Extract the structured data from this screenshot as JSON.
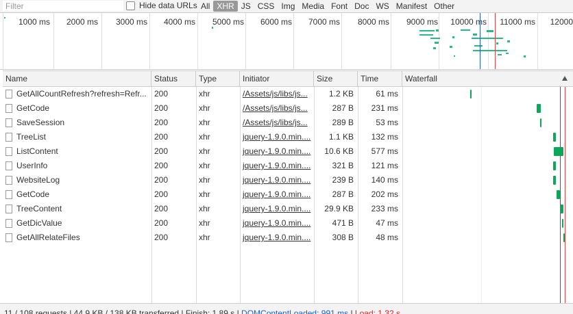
{
  "filter": {
    "placeholder": "Filter",
    "hide_data_urls": "Hide data URLs"
  },
  "type_filters": [
    "All",
    "XHR",
    "JS",
    "CSS",
    "Img",
    "Media",
    "Font",
    "Doc",
    "WS",
    "Manifest",
    "Other"
  ],
  "active_filter": "XHR",
  "overview": {
    "ticks": [
      "1000 ms",
      "2000 ms",
      "3000 ms",
      "4000 ms",
      "5000 ms",
      "6000 ms",
      "7000 ms",
      "8000 ms",
      "9000 ms",
      "10000 ms",
      "11000 ms",
      "12000"
    ]
  },
  "columns": [
    "Name",
    "Status",
    "Type",
    "Initiator",
    "Size",
    "Time",
    "Waterfall"
  ],
  "rows": [
    {
      "name": "GetAllCountRefresh?refresh=Refr...",
      "status": "200",
      "type": "xhr",
      "initiator": "/Assets/js/libs/js...",
      "size": "1.2 KB",
      "time": "61 ms"
    },
    {
      "name": "GetCode",
      "status": "200",
      "type": "xhr",
      "initiator": "/Assets/js/libs/js...",
      "size": "287 B",
      "time": "231 ms"
    },
    {
      "name": "SaveSession",
      "status": "200",
      "type": "xhr",
      "initiator": "/Assets/js/libs/js...",
      "size": "289 B",
      "time": "53 ms"
    },
    {
      "name": "TreeList",
      "status": "200",
      "type": "xhr",
      "initiator": "jquery-1.9.0.min....",
      "size": "1.1 KB",
      "time": "132 ms"
    },
    {
      "name": "ListContent",
      "status": "200",
      "type": "xhr",
      "initiator": "jquery-1.9.0.min....",
      "size": "10.6 KB",
      "time": "577 ms"
    },
    {
      "name": "UserInfo",
      "status": "200",
      "type": "xhr",
      "initiator": "jquery-1.9.0.min....",
      "size": "321 B",
      "time": "121 ms"
    },
    {
      "name": "WebsiteLog",
      "status": "200",
      "type": "xhr",
      "initiator": "jquery-1.9.0.min....",
      "size": "239 B",
      "time": "140 ms"
    },
    {
      "name": "GetCode",
      "status": "200",
      "type": "xhr",
      "initiator": "jquery-1.9.0.min....",
      "size": "287 B",
      "time": "202 ms"
    },
    {
      "name": "TreeContent",
      "status": "200",
      "type": "xhr",
      "initiator": "jquery-1.9.0.min....",
      "size": "29.9 KB",
      "time": "233 ms"
    },
    {
      "name": "GetDicValue",
      "status": "200",
      "type": "xhr",
      "initiator": "jquery-1.9.0.min....",
      "size": "471 B",
      "time": "47 ms"
    },
    {
      "name": "GetAllRelateFiles",
      "status": "200",
      "type": "xhr",
      "initiator": "jquery-1.9.0.min....",
      "size": "308 B",
      "time": "48 ms"
    }
  ],
  "status_bar": {
    "requests": "11 / 108 requests",
    "transferred": "44.9 KB / 138 KB transferred",
    "finish": "Finish: 1.89 s",
    "dom_content_loaded": "DOMContentLoaded: 991 ms",
    "load": "Load: 1.32 s"
  },
  "colors": {
    "bar_green": "#0fa55a",
    "dcl_blue": "#1a5fd2",
    "load_red": "#d22222",
    "active_filter_bg": "#999999"
  }
}
